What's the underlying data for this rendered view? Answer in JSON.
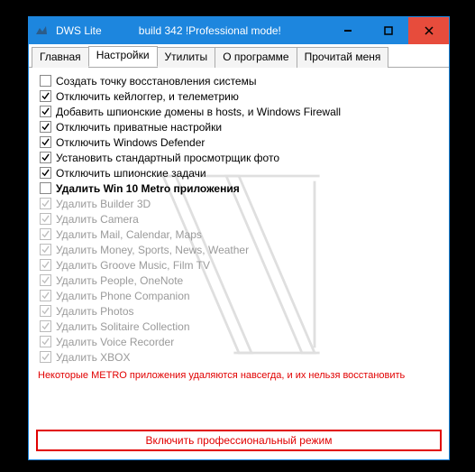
{
  "window": {
    "title": "DWS Lite",
    "subtitle": "build 342  !Professional mode!"
  },
  "tabs": [
    {
      "label": "Главная",
      "active": false
    },
    {
      "label": "Настройки",
      "active": true
    },
    {
      "label": "Утилиты",
      "active": false
    },
    {
      "label": "О программе",
      "active": false
    },
    {
      "label": "Прочитай меня",
      "active": false
    }
  ],
  "options": [
    {
      "label": "Создать точку восстановления системы",
      "checked": false,
      "enabled": true,
      "bold": false
    },
    {
      "label": "Отключить кейлоггер, и телеметрию",
      "checked": true,
      "enabled": true,
      "bold": false
    },
    {
      "label": "Добавить шпионские домены в hosts, и Windows Firewall",
      "checked": true,
      "enabled": true,
      "bold": false
    },
    {
      "label": "Отключить приватные настройки",
      "checked": true,
      "enabled": true,
      "bold": false
    },
    {
      "label": "Отключить Windows Defender",
      "checked": true,
      "enabled": true,
      "bold": false
    },
    {
      "label": "Установить стандартный просмотрщик фото",
      "checked": true,
      "enabled": true,
      "bold": false
    },
    {
      "label": "Отключить шпионские задачи",
      "checked": true,
      "enabled": true,
      "bold": false
    },
    {
      "label": "Удалить Win 10 Metro приложения",
      "checked": false,
      "enabled": true,
      "bold": true
    },
    {
      "label": "Удалить Builder 3D",
      "checked": true,
      "enabled": false,
      "bold": false
    },
    {
      "label": "Удалить Camera",
      "checked": true,
      "enabled": false,
      "bold": false
    },
    {
      "label": "Удалить Mail, Calendar, Maps",
      "checked": true,
      "enabled": false,
      "bold": false
    },
    {
      "label": "Удалить Money, Sports, News, Weather",
      "checked": true,
      "enabled": false,
      "bold": false
    },
    {
      "label": "Удалить Groove Music, Film TV",
      "checked": true,
      "enabled": false,
      "bold": false
    },
    {
      "label": "Удалить People, OneNote",
      "checked": true,
      "enabled": false,
      "bold": false
    },
    {
      "label": "Удалить Phone Companion",
      "checked": true,
      "enabled": false,
      "bold": false
    },
    {
      "label": "Удалить Photos",
      "checked": true,
      "enabled": false,
      "bold": false
    },
    {
      "label": "Удалить Solitaire Collection",
      "checked": true,
      "enabled": false,
      "bold": false
    },
    {
      "label": "Удалить Voice Recorder",
      "checked": true,
      "enabled": false,
      "bold": false
    },
    {
      "label": "Удалить XBOX",
      "checked": true,
      "enabled": false,
      "bold": false
    }
  ],
  "warning": "Некоторые METRO приложения удаляются навсегда, и их нельзя восстановить",
  "pro_button": "Включить профессиональный режим"
}
